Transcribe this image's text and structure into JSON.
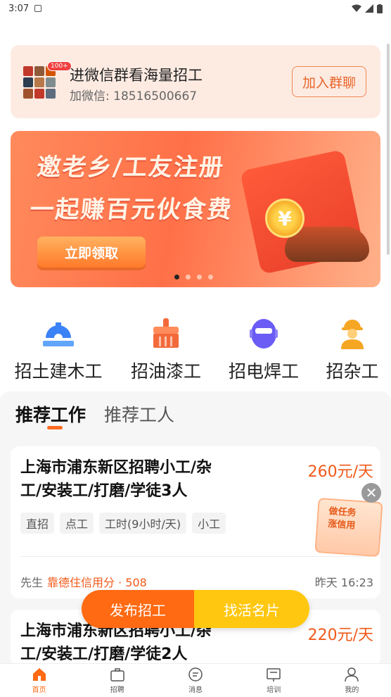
{
  "status_bar": {
    "time": "3:07"
  },
  "wechat": {
    "badge": "100+",
    "title": "进微信群看海量招工",
    "subtitle": "加微信: 18516500667",
    "button": "加入群聊"
  },
  "banner": {
    "line1": "邀老乡/工友注册",
    "line2": "一起赚百元伙食费",
    "cta": "立即领取",
    "coin_symbol": "¥"
  },
  "categories": [
    {
      "label": "招土建木工",
      "icon": "construction-icon",
      "color": "#3b82f6"
    },
    {
      "label": "招油漆工",
      "icon": "paint-brush-icon",
      "color": "#f36a3a"
    },
    {
      "label": "招电焊工",
      "icon": "welding-mask-icon",
      "color": "#6a5cf5"
    },
    {
      "label": "招杂工",
      "icon": "worker-icon",
      "color": "#f5a623"
    }
  ],
  "tabs": {
    "active": "推荐工作",
    "other": "推荐工人"
  },
  "jobs": [
    {
      "title": "上海市浦东新区招聘小工/杂工/安装工/打磨/学徒3人",
      "pay": "260元/天",
      "tags": [
        "直招",
        "点工",
        "工时(9小时/天)",
        "小工"
      ],
      "poster": "先生",
      "credit": "靠德住信用分 · 508",
      "time": "昨天 16:23"
    },
    {
      "title": "上海市浦东新区招聘小工/杂工/安装工/打磨/学徒2人",
      "pay": "220元/天"
    }
  ],
  "task_note": {
    "line1": "做任务",
    "line2": "涨信用"
  },
  "fab": {
    "left": "发布招工",
    "right": "找活名片"
  },
  "bottom_nav": [
    {
      "label": "首页",
      "icon": "home-icon",
      "active": true
    },
    {
      "label": "招聘",
      "icon": "briefcase-icon",
      "active": false
    },
    {
      "label": "消息",
      "icon": "message-icon",
      "active": false
    },
    {
      "label": "培训",
      "icon": "training-icon",
      "active": false
    },
    {
      "label": "我的",
      "icon": "profile-icon",
      "active": false
    }
  ],
  "colors": {
    "accent": "#ff6a12",
    "pay": "#f05a1a",
    "fab_secondary": "#ffc70f"
  }
}
